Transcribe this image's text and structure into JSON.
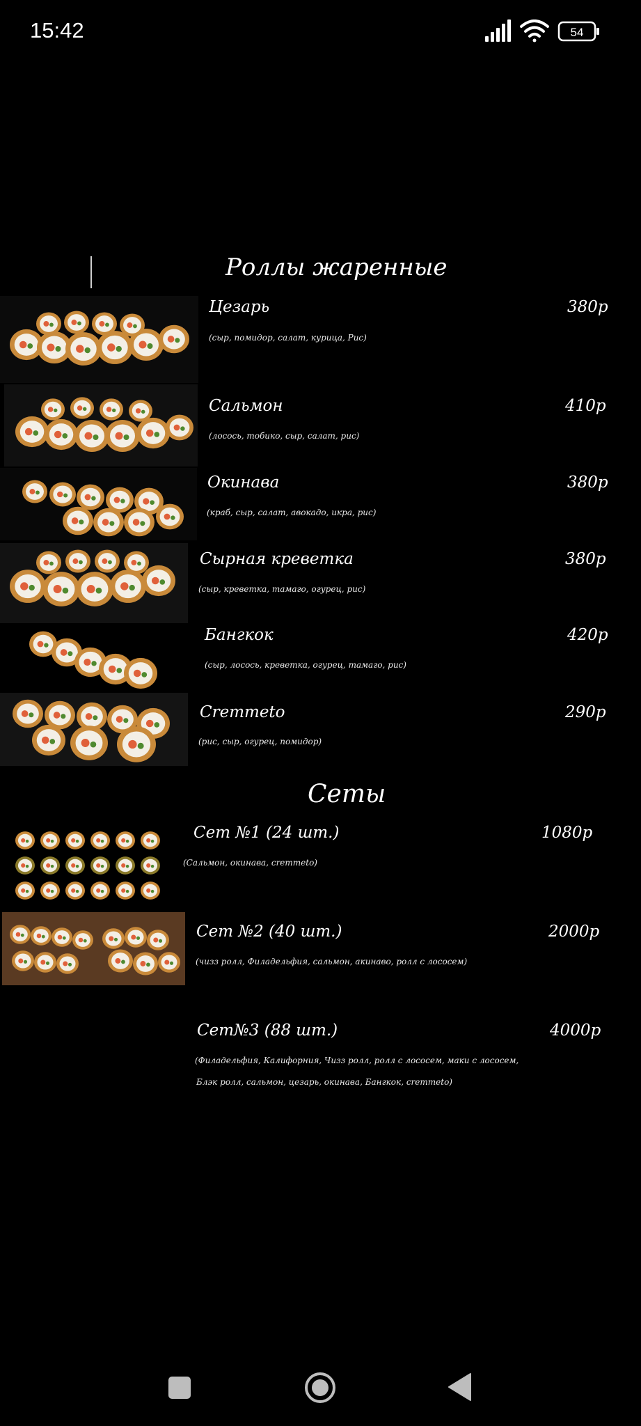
{
  "status_bar": {
    "time": "15:42",
    "battery": "54",
    "icons": [
      "signal-icon",
      "wifi-icon",
      "battery-icon"
    ]
  },
  "menu": {
    "sections": [
      {
        "title": "Роллы жаренные",
        "items": [
          {
            "name": "Цезарь",
            "price": "380р",
            "desc": "(сыр, помидор, салат, курица, Рис)"
          },
          {
            "name": "Сальмон",
            "price": "410р",
            "desc": "(лосось, тобико, сыр, салат, рис)"
          },
          {
            "name": "Окинава",
            "price": "380р",
            "desc": "(краб, сыр, салат, авокадо, икра, рис)"
          },
          {
            "name": "Сырная креветка",
            "price": "380р",
            "desc": "(сыр, креветка, тамаго, огурец, рис)"
          },
          {
            "name": "Бангкок",
            "price": "420р",
            "desc": "(сыр, лосось, креветка, огурец, тамаго, рис)"
          },
          {
            "name": "Cremmeto",
            "price": "290р",
            "desc": "(рис, сыр, огурец, помидор)"
          }
        ]
      },
      {
        "title": "Сеты",
        "items": [
          {
            "name": "Сет №1 (24 шт.)",
            "price": "1080р",
            "desc": "(Сальмон, окинава, cremmeto)"
          },
          {
            "name": "Сет №2 (40 шт.)",
            "price": "2000р",
            "desc": "(чизз ролл, Филадельфия, сальмон, акинаво, ролл с лососем)"
          },
          {
            "name": "Сет№3 (88 шт.)",
            "price": "4000р",
            "desc": "(Филадельфия, Калифорния, Чизз ролл, ролл с лососем, маки с лососем,",
            "desc2": "Блэк ролл, сальмон, цезарь, окинава, Бангкок, cremmeto)"
          }
        ]
      }
    ]
  },
  "nav_bar": {
    "buttons": [
      "recents-square-icon",
      "home-circle-icon",
      "back-triangle-icon"
    ]
  },
  "colors": {
    "background": "#000000",
    "text": "#ffffff",
    "roll_gold": "#c98a3a",
    "roll_rice": "#f3efe6",
    "salmon": "#e0603a",
    "cucumber": "#4f8a2f"
  }
}
